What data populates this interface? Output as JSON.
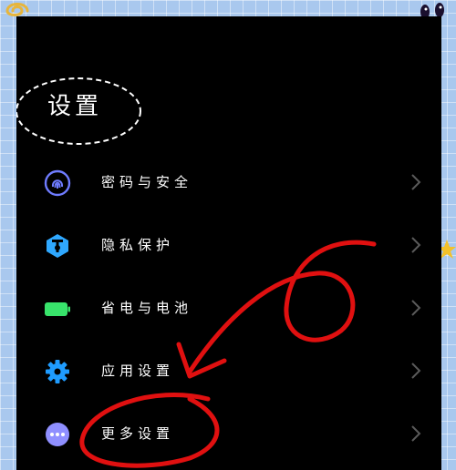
{
  "page": {
    "title": "设置"
  },
  "settings": {
    "items": [
      {
        "label": "密码与安全",
        "icon": "fingerprint-icon",
        "icon_color": "#6f7cff"
      },
      {
        "label": "隐私保护",
        "icon": "shield-icon",
        "icon_color": "#2fa8ff"
      },
      {
        "label": "省电与电池",
        "icon": "battery-icon",
        "icon_color": "#38e36b"
      },
      {
        "label": "应用设置",
        "icon": "gear-icon",
        "icon_color": "#1f9cff"
      },
      {
        "label": "更多设置",
        "icon": "more-dots-icon",
        "icon_color": "#8f8fff"
      }
    ]
  },
  "annotation": {
    "color": "#e01010"
  }
}
